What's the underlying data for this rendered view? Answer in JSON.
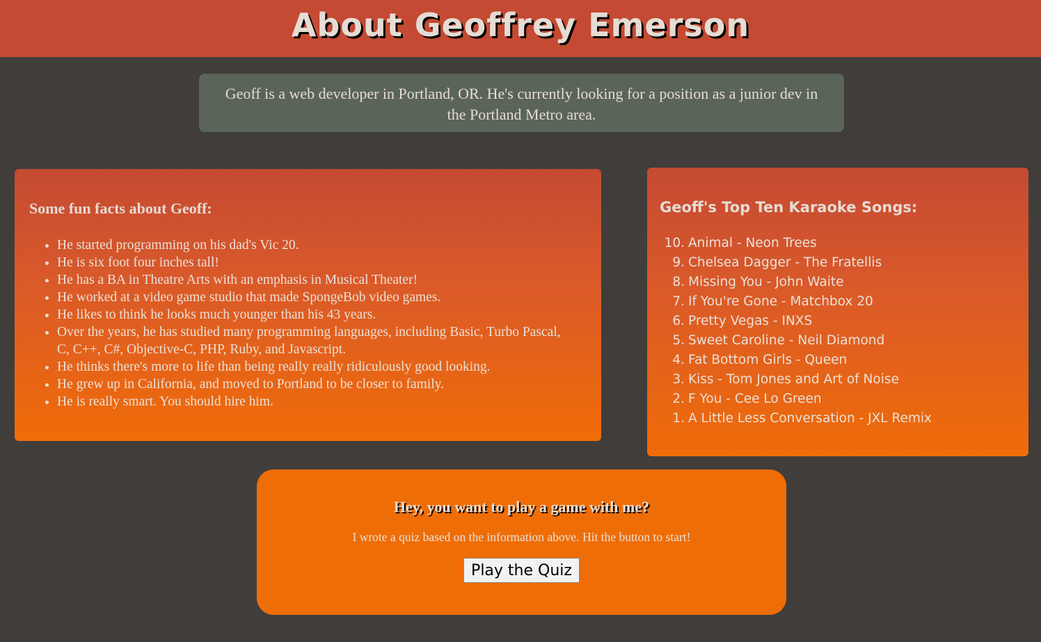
{
  "header": {
    "title": "About Geoffrey Emerson"
  },
  "intro": {
    "text": "Geoff is a web developer in Portland, OR. He's currently looking for a position as a junior dev in the Portland Metro area."
  },
  "facts": {
    "heading": "Some fun facts about Geoff:",
    "items": [
      "He started programming on his dad's Vic 20.",
      "He is six foot four inches tall!",
      "He has a BA in Theatre Arts with an emphasis in Musical Theater!",
      "He worked at a video game studio that made SpongeBob video games.",
      "He likes to think he looks much younger than his 43 years.",
      "Over the years, he has studied many programming languages, including Basic, Turbo Pascal, C, C++, C#, Objective-C, PHP, Ruby, and Javascript.",
      "He thinks there's more to life than being really really ridiculously good looking.",
      "He grew up in California, and moved to Portland to be closer to family.",
      "He is really smart. You should hire him."
    ]
  },
  "songs": {
    "heading": "Geoff's Top Ten Karaoke Songs:",
    "items": [
      {
        "num": "10.",
        "title": "Animal - Neon Trees"
      },
      {
        "num": "9.",
        "title": "Chelsea Dagger - The Fratellis"
      },
      {
        "num": "8.",
        "title": "Missing You - John Waite"
      },
      {
        "num": "7.",
        "title": "If You're Gone - Matchbox 20"
      },
      {
        "num": "6.",
        "title": "Pretty Vegas - INXS"
      },
      {
        "num": "5.",
        "title": "Sweet Caroline - Neil Diamond"
      },
      {
        "num": "4.",
        "title": "Fat Bottom Girls - Queen"
      },
      {
        "num": "3.",
        "title": "Kiss - Tom Jones and Art of Noise"
      },
      {
        "num": "2.",
        "title": "F You - Cee Lo Green"
      },
      {
        "num": "1.",
        "title": "A Little Less Conversation - JXL Remix"
      }
    ]
  },
  "quiz": {
    "heading": "Hey, you want to play a game with me?",
    "description": "I wrote a quiz based on the information above. Hit the button to start!",
    "button_label": "Play the Quiz"
  },
  "colors": {
    "header_bg": "#c44a33",
    "page_bg": "#403d3b",
    "intro_bg": "#5a6458",
    "accent_orange": "#ef6d07"
  }
}
